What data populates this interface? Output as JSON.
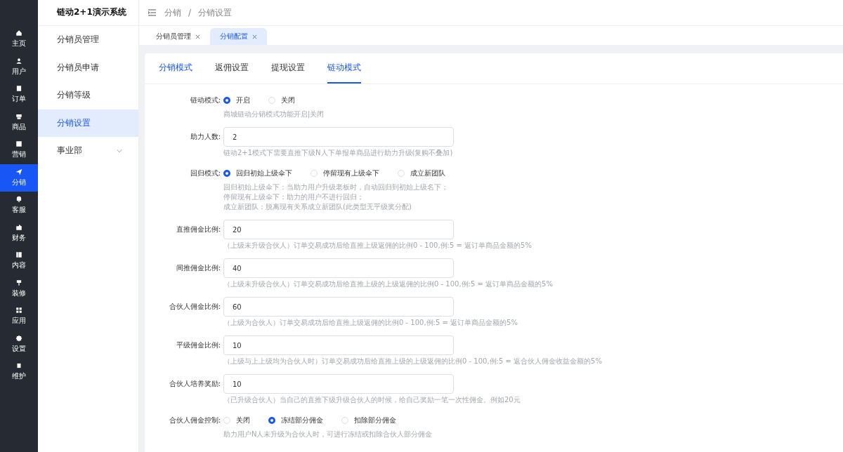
{
  "app_title": "链动2+1演示系统",
  "nav": [
    {
      "label": "主页",
      "selected": false
    },
    {
      "label": "用户",
      "selected": false
    },
    {
      "label": "订单",
      "selected": false
    },
    {
      "label": "商品",
      "selected": false
    },
    {
      "label": "营销",
      "selected": false
    },
    {
      "label": "分销",
      "selected": true
    },
    {
      "label": "客服",
      "selected": false
    },
    {
      "label": "财务",
      "selected": false
    },
    {
      "label": "内容",
      "selected": false
    },
    {
      "label": "装修",
      "selected": false
    },
    {
      "label": "应用",
      "selected": false
    },
    {
      "label": "设置",
      "selected": false
    },
    {
      "label": "维护",
      "selected": false
    }
  ],
  "sidebar": {
    "items": [
      {
        "label": "分销员管理",
        "selected": false
      },
      {
        "label": "分销员申请",
        "selected": false
      },
      {
        "label": "分销等级",
        "selected": false
      },
      {
        "label": "分销设置",
        "selected": true
      },
      {
        "label": "事业部",
        "selected": false,
        "expanded": false
      }
    ]
  },
  "breadcrumb": [
    "分销",
    "分销设置"
  ],
  "breadcrumb_separator": "/",
  "page_tabs": [
    {
      "label": "分销员管理",
      "selected": false
    },
    {
      "label": "分销配置",
      "selected": true
    }
  ],
  "tabs": [
    {
      "label": "分销模式",
      "selected": false,
      "highlighted": true
    },
    {
      "label": "返佣设置",
      "selected": false,
      "highlighted": false
    },
    {
      "label": "提现设置",
      "selected": false,
      "highlighted": false
    },
    {
      "label": "链动模式",
      "selected": true,
      "highlighted": true
    }
  ],
  "form": [
    {
      "kind": "radio",
      "label": "链动模式:",
      "options": [
        {
          "label": "开启",
          "selected": true
        },
        {
          "label": "关闭",
          "selected": false
        }
      ],
      "help": [
        "商城链动分销模式功能开启|关闭"
      ]
    },
    {
      "kind": "input",
      "label": "助力人数:",
      "value": "2",
      "help": [
        "链动2+1模式下需要直推下级N人下单报单商品进行助力升级(复购不叠加)"
      ]
    },
    {
      "kind": "radio",
      "label": "回归模式:",
      "options": [
        {
          "label": "回归初始上级伞下",
          "selected": true
        },
        {
          "label": "停留现有上级伞下",
          "selected": false
        },
        {
          "label": "成立新团队",
          "selected": false
        }
      ],
      "help": [
        "回归初始上级伞下：当助力用户升级老板时，自动回归到初始上级名下；",
        "停留现有上级伞下：助力的用户不进行回归；",
        "成立新团队：脱离现有关系成立新团队(此类型无平级奖分配)"
      ]
    },
    {
      "kind": "input",
      "label": "直推佣金比例:",
      "value": "20",
      "help": [
        "（上级未升级合伙人）订单交易成功后给直推上级返佣的比例0 - 100,例:5 = 返订单商品金额的5%"
      ]
    },
    {
      "kind": "input",
      "label": "间推佣金比例:",
      "value": "40",
      "help": [
        "（上级未升级合伙人）订单交易成功后给直推上级的上级返佣的比例0 - 100,例:5 = 返订单商品金额的5%"
      ]
    },
    {
      "kind": "input",
      "label": "合伙人佣金比例:",
      "value": "60",
      "help": [
        "（上级为合伙人）订单交易成功后给直推上级返佣的比例0 - 100,例:5 = 返订单商品金额的5%"
      ]
    },
    {
      "kind": "input",
      "label": "平级佣金比例:",
      "value": "10",
      "help": [
        "（上级与上上级均为合伙人时）订单交易成功后给直推上级的上级返佣的比例0 - 100,例:5 = 返合伙人佣金收益金额的5%"
      ]
    },
    {
      "kind": "input",
      "label": "合伙人培养奖励:",
      "value": "10",
      "help": [
        "（已升级合伙人）当自己的直推下级升级合伙人的时候，给自己奖励一笔一次性佣金。例如20元"
      ]
    },
    {
      "kind": "radio",
      "label": "合伙人佣金控制:",
      "options": [
        {
          "label": "关闭",
          "selected": false
        },
        {
          "label": "冻结部分佣金",
          "selected": true
        },
        {
          "label": "扣除部分佣金",
          "selected": false
        }
      ],
      "help": [
        "助力用户N人未升级为合伙人时，可进行冻结或扣除合伙人部分佣金"
      ]
    }
  ]
}
